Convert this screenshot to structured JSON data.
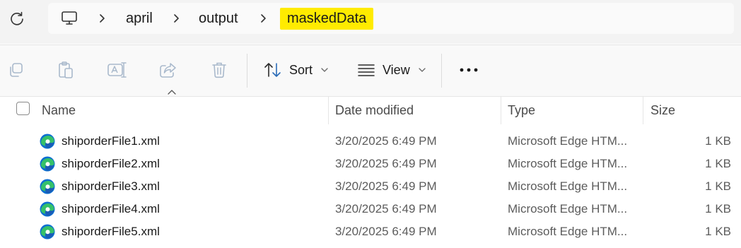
{
  "breadcrumb": {
    "root_icon": "this-pc-icon",
    "items": [
      "april",
      "output",
      "maskedData"
    ]
  },
  "toolbar": {
    "actions": [
      "copy-icon",
      "paste-icon",
      "rename-icon",
      "share-icon",
      "delete-icon"
    ],
    "sort_label": "Sort",
    "view_label": "View",
    "more_icon": "more-options-icon"
  },
  "columns": {
    "name": "Name",
    "date": "Date modified",
    "type": "Type",
    "size": "Size"
  },
  "files": [
    {
      "name": "shiporderFile1.xml",
      "date": "3/20/2025 6:49 PM",
      "type": "Microsoft Edge HTM...",
      "size": "1 KB"
    },
    {
      "name": "shiporderFile2.xml",
      "date": "3/20/2025 6:49 PM",
      "type": "Microsoft Edge HTM...",
      "size": "1 KB"
    },
    {
      "name": "shiporderFile3.xml",
      "date": "3/20/2025 6:49 PM",
      "type": "Microsoft Edge HTM...",
      "size": "1 KB"
    },
    {
      "name": "shiporderFile4.xml",
      "date": "3/20/2025 6:49 PM",
      "type": "Microsoft Edge HTM...",
      "size": "1 KB"
    },
    {
      "name": "shiporderFile5.xml",
      "date": "3/20/2025 6:49 PM",
      "type": "Microsoft Edge HTM...",
      "size": "1 KB"
    }
  ],
  "colors": {
    "highlight": "#ffeb00",
    "edge_blue": "#0c6fd0",
    "edge_green": "#35c16a"
  }
}
